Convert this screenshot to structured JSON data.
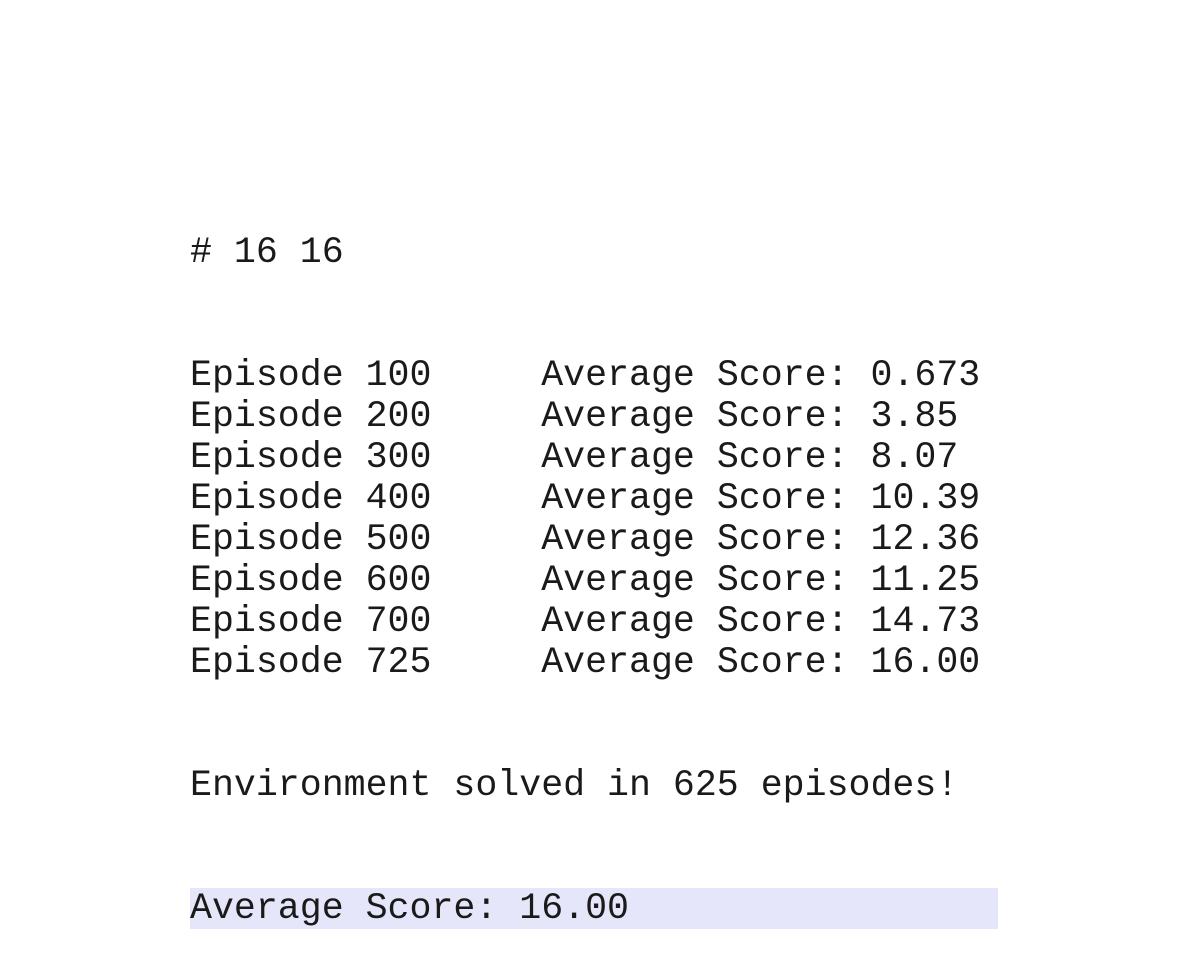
{
  "output": {
    "header": "# 16 16",
    "episodes": [
      {
        "episode": "100",
        "score": "0.673"
      },
      {
        "episode": "200",
        "score": "3.85"
      },
      {
        "episode": "300",
        "score": "8.07"
      },
      {
        "episode": "400",
        "score": "10.39"
      },
      {
        "episode": "500",
        "score": "12.36"
      },
      {
        "episode": "600",
        "score": "11.25"
      },
      {
        "episode": "700",
        "score": "14.73"
      },
      {
        "episode": "725",
        "score": "16.00"
      }
    ],
    "episode_label": "Episode",
    "score_label": "Average Score:",
    "solved_message": "Environment solved in 625 episodes!",
    "final_score_line": "Average Score: 16.00"
  },
  "colors": {
    "text": "#1a1a1a",
    "highlight": "#e6e6fa",
    "background": "#ffffff"
  }
}
